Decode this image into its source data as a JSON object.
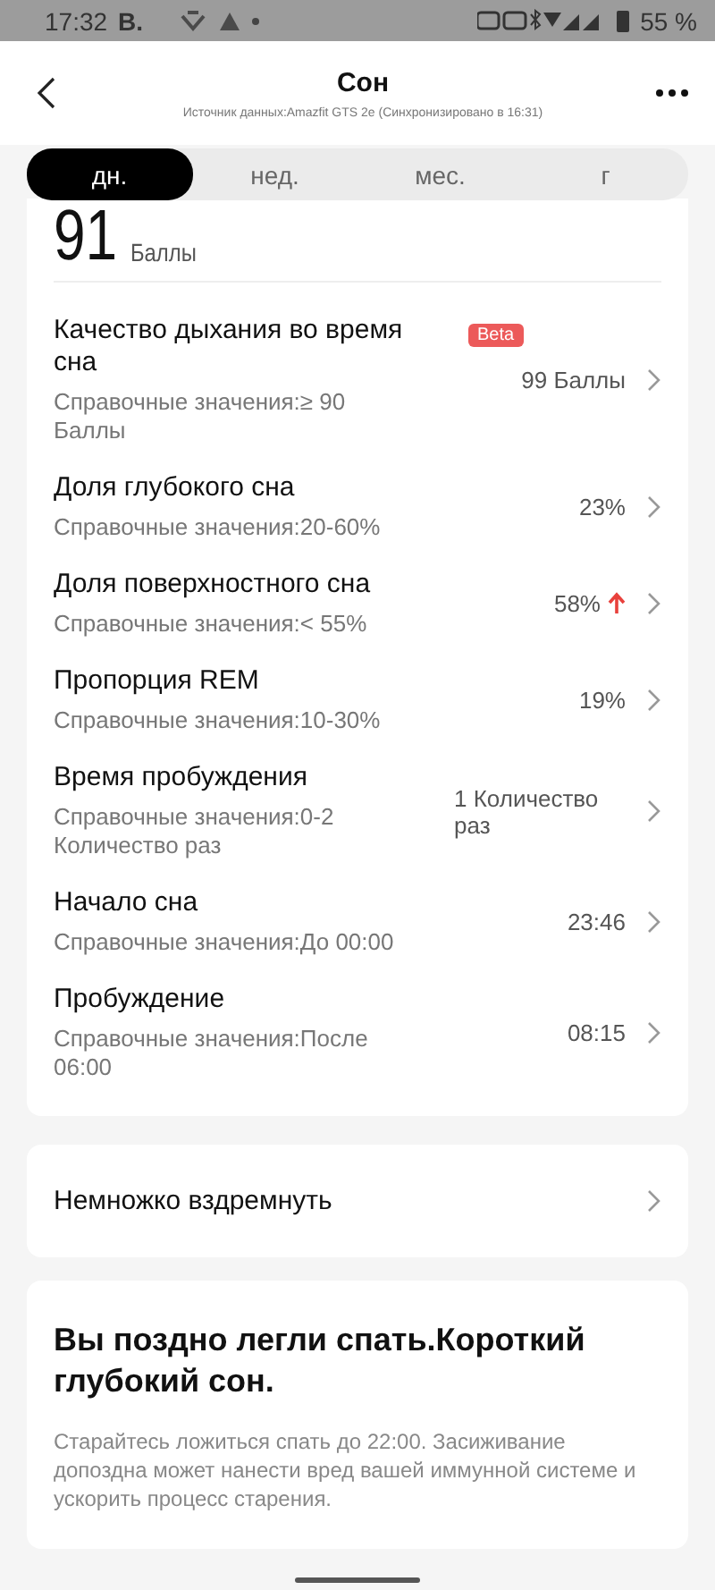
{
  "status_bar": {
    "time": "17:32",
    "carrier": "В.",
    "battery": "55 %"
  },
  "header": {
    "title": "Сон",
    "source": "Источник данных:Amazfit GTS 2e (Синхронизировано в 16:31)"
  },
  "tabs": [
    {
      "label": "дн.",
      "selected": true
    },
    {
      "label": "нед.",
      "selected": false
    },
    {
      "label": "мес.",
      "selected": false
    },
    {
      "label": "г",
      "selected": false
    }
  ],
  "score": {
    "value": "91",
    "unit": "Баллы"
  },
  "metrics": [
    {
      "title": "Качество дыхания во время сна",
      "badge": "Beta",
      "reference": "Справочные значения:≥ 90 Баллы",
      "value": "99 Баллы",
      "rising": false
    },
    {
      "title": "Доля глубокого сна",
      "reference": "Справочные значения:20-60%",
      "value": "23%",
      "rising": false
    },
    {
      "title": "Доля поверхностного сна",
      "reference": "Справочные значения:< 55%",
      "value": "58%",
      "rising": true
    },
    {
      "title": "Пропорция REM",
      "reference": "Справочные значения:10-30%",
      "value": "19%",
      "rising": false
    },
    {
      "title": "Время пробуждения",
      "reference": "Справочные значения:0-2 Количество раз",
      "value": "1 Количество раз",
      "rising": false
    },
    {
      "title": "Начало сна",
      "reference": "Справочные значения:До 00:00",
      "value": "23:46",
      "rising": false
    },
    {
      "title": "Пробуждение",
      "reference": "Справочные значения:После 06:00",
      "value": "08:15",
      "rising": false
    }
  ],
  "nap": {
    "label": "Немножко вздремнуть"
  },
  "advice": {
    "title": "Вы поздно легли спать.Короткий глубокий сон.",
    "text": "Старайтесь ложиться спать до 22:00. Засиживание допоздна может нанести вред вашей иммунной системе и ускорить процесс старения."
  }
}
